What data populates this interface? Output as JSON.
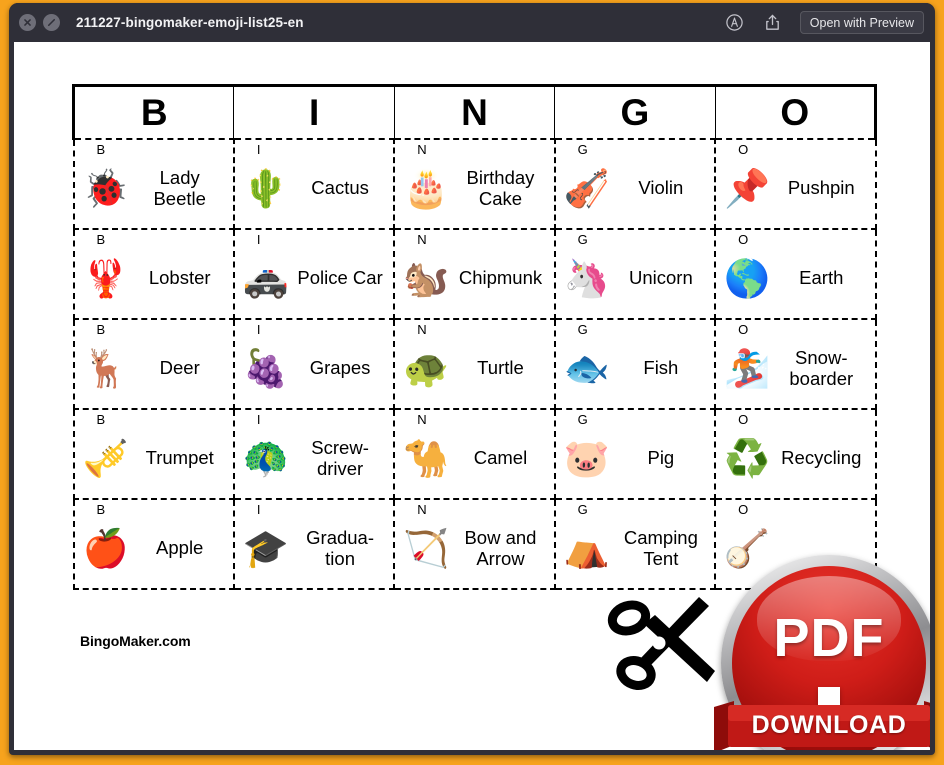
{
  "window": {
    "titlebar": {
      "close_icon": "close-circle-icon",
      "block_icon": "no-entry-circle-icon",
      "filename": "211227-bingomaker-emoji-list25-en",
      "markup_icon": "markup-annotate-icon",
      "share_icon": "share-icon",
      "open_with_label": "Open with Preview"
    },
    "background_color": "#2f2f38",
    "frame_color": "#f7a31d"
  },
  "card": {
    "header": [
      "B",
      "I",
      "N",
      "G",
      "O"
    ],
    "brand": "BingoMaker.com",
    "rows": [
      [
        {
          "letter": "B",
          "emoji": "🐞",
          "emoji_name": "lady-beetle-emoji",
          "label": "Lady Beetle"
        },
        {
          "letter": "I",
          "emoji": "🌵",
          "emoji_name": "cactus-emoji",
          "label": "Cactus"
        },
        {
          "letter": "N",
          "emoji": "🎂",
          "emoji_name": "birthday-cake-emoji",
          "label": "Birthday Cake"
        },
        {
          "letter": "G",
          "emoji": "🎻",
          "emoji_name": "violin-emoji",
          "label": "Violin"
        },
        {
          "letter": "O",
          "emoji": "📌",
          "emoji_name": "pushpin-emoji",
          "label": "Pushpin"
        }
      ],
      [
        {
          "letter": "B",
          "emoji": "🦞",
          "emoji_name": "lobster-emoji",
          "label": "Lobster"
        },
        {
          "letter": "I",
          "emoji": "🚓",
          "emoji_name": "police-car-emoji",
          "label": "Police Car"
        },
        {
          "letter": "N",
          "emoji": "🐿️",
          "emoji_name": "chipmunk-emoji",
          "label": "Chipmunk"
        },
        {
          "letter": "G",
          "emoji": "🦄",
          "emoji_name": "unicorn-emoji",
          "label": "Unicorn"
        },
        {
          "letter": "O",
          "emoji": "🌎",
          "emoji_name": "earth-emoji",
          "label": "Earth"
        }
      ],
      [
        {
          "letter": "B",
          "emoji": "🦌",
          "emoji_name": "deer-emoji",
          "label": "Deer"
        },
        {
          "letter": "I",
          "emoji": "🍇",
          "emoji_name": "grapes-emoji",
          "label": "Grapes"
        },
        {
          "letter": "N",
          "emoji": "🐢",
          "emoji_name": "turtle-emoji",
          "label": "Turtle"
        },
        {
          "letter": "G",
          "emoji": "🐟",
          "emoji_name": "fish-emoji",
          "label": "Fish"
        },
        {
          "letter": "O",
          "emoji": "🏂",
          "emoji_name": "snowboarder-emoji",
          "label": "Snow-boarder"
        }
      ],
      [
        {
          "letter": "B",
          "emoji": "🎺",
          "emoji_name": "trumpet-emoji",
          "label": "Trumpet"
        },
        {
          "letter": "I",
          "emoji": "🦚",
          "emoji_name": "screwdriver-emoji",
          "label": "Screw-driver"
        },
        {
          "letter": "N",
          "emoji": "🐪",
          "emoji_name": "camel-emoji",
          "label": "Camel"
        },
        {
          "letter": "G",
          "emoji": "🐷",
          "emoji_name": "pig-emoji",
          "label": "Pig"
        },
        {
          "letter": "O",
          "emoji": "♻️",
          "emoji_name": "recycling-emoji",
          "label": "Recycling"
        }
      ],
      [
        {
          "letter": "B",
          "emoji": "🍎",
          "emoji_name": "apple-emoji",
          "label": "Apple"
        },
        {
          "letter": "I",
          "emoji": "🎓",
          "emoji_name": "graduation-cap-emoji",
          "label": "Gradua-tion"
        },
        {
          "letter": "N",
          "emoji": "🏹",
          "emoji_name": "bow-and-arrow-emoji",
          "label": "Bow and Arrow"
        },
        {
          "letter": "G",
          "emoji": "⛺",
          "emoji_name": "camping-tent-emoji",
          "label": "Camping Tent"
        },
        {
          "letter": "O",
          "emoji": "🪕",
          "emoji_name": "banjo-emoji",
          "label": ""
        }
      ]
    ]
  },
  "overlay": {
    "scissors_icon": "scissors-icon",
    "pdf_label": "PDF",
    "download_label": "DOWNLOAD",
    "badge_color": "#cf1d18"
  }
}
